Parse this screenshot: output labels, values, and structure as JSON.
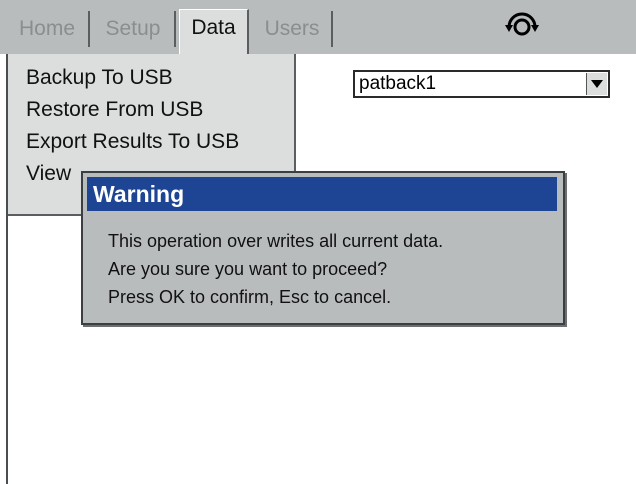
{
  "tabs": [
    {
      "label": "Home",
      "active": false
    },
    {
      "label": "Setup",
      "active": false
    },
    {
      "label": "Data",
      "active": true
    },
    {
      "label": "Users",
      "active": false
    }
  ],
  "header": {
    "status_icon": "sync-icon"
  },
  "menu": {
    "items": [
      {
        "label": "Backup To USB"
      },
      {
        "label": "Restore From USB"
      },
      {
        "label": "Export Results To USB"
      },
      {
        "label": "View"
      }
    ]
  },
  "backup_select": {
    "value": "patback1"
  },
  "dialog": {
    "title": "Warning",
    "lines": [
      "This operation over writes all current data.",
      "Are you sure you want to proceed?",
      "Press OK to confirm, Esc to cancel."
    ]
  },
  "colors": {
    "title_bar": "#1e4593",
    "panel": "#dcdddd",
    "chrome": "#b9bcbd"
  }
}
